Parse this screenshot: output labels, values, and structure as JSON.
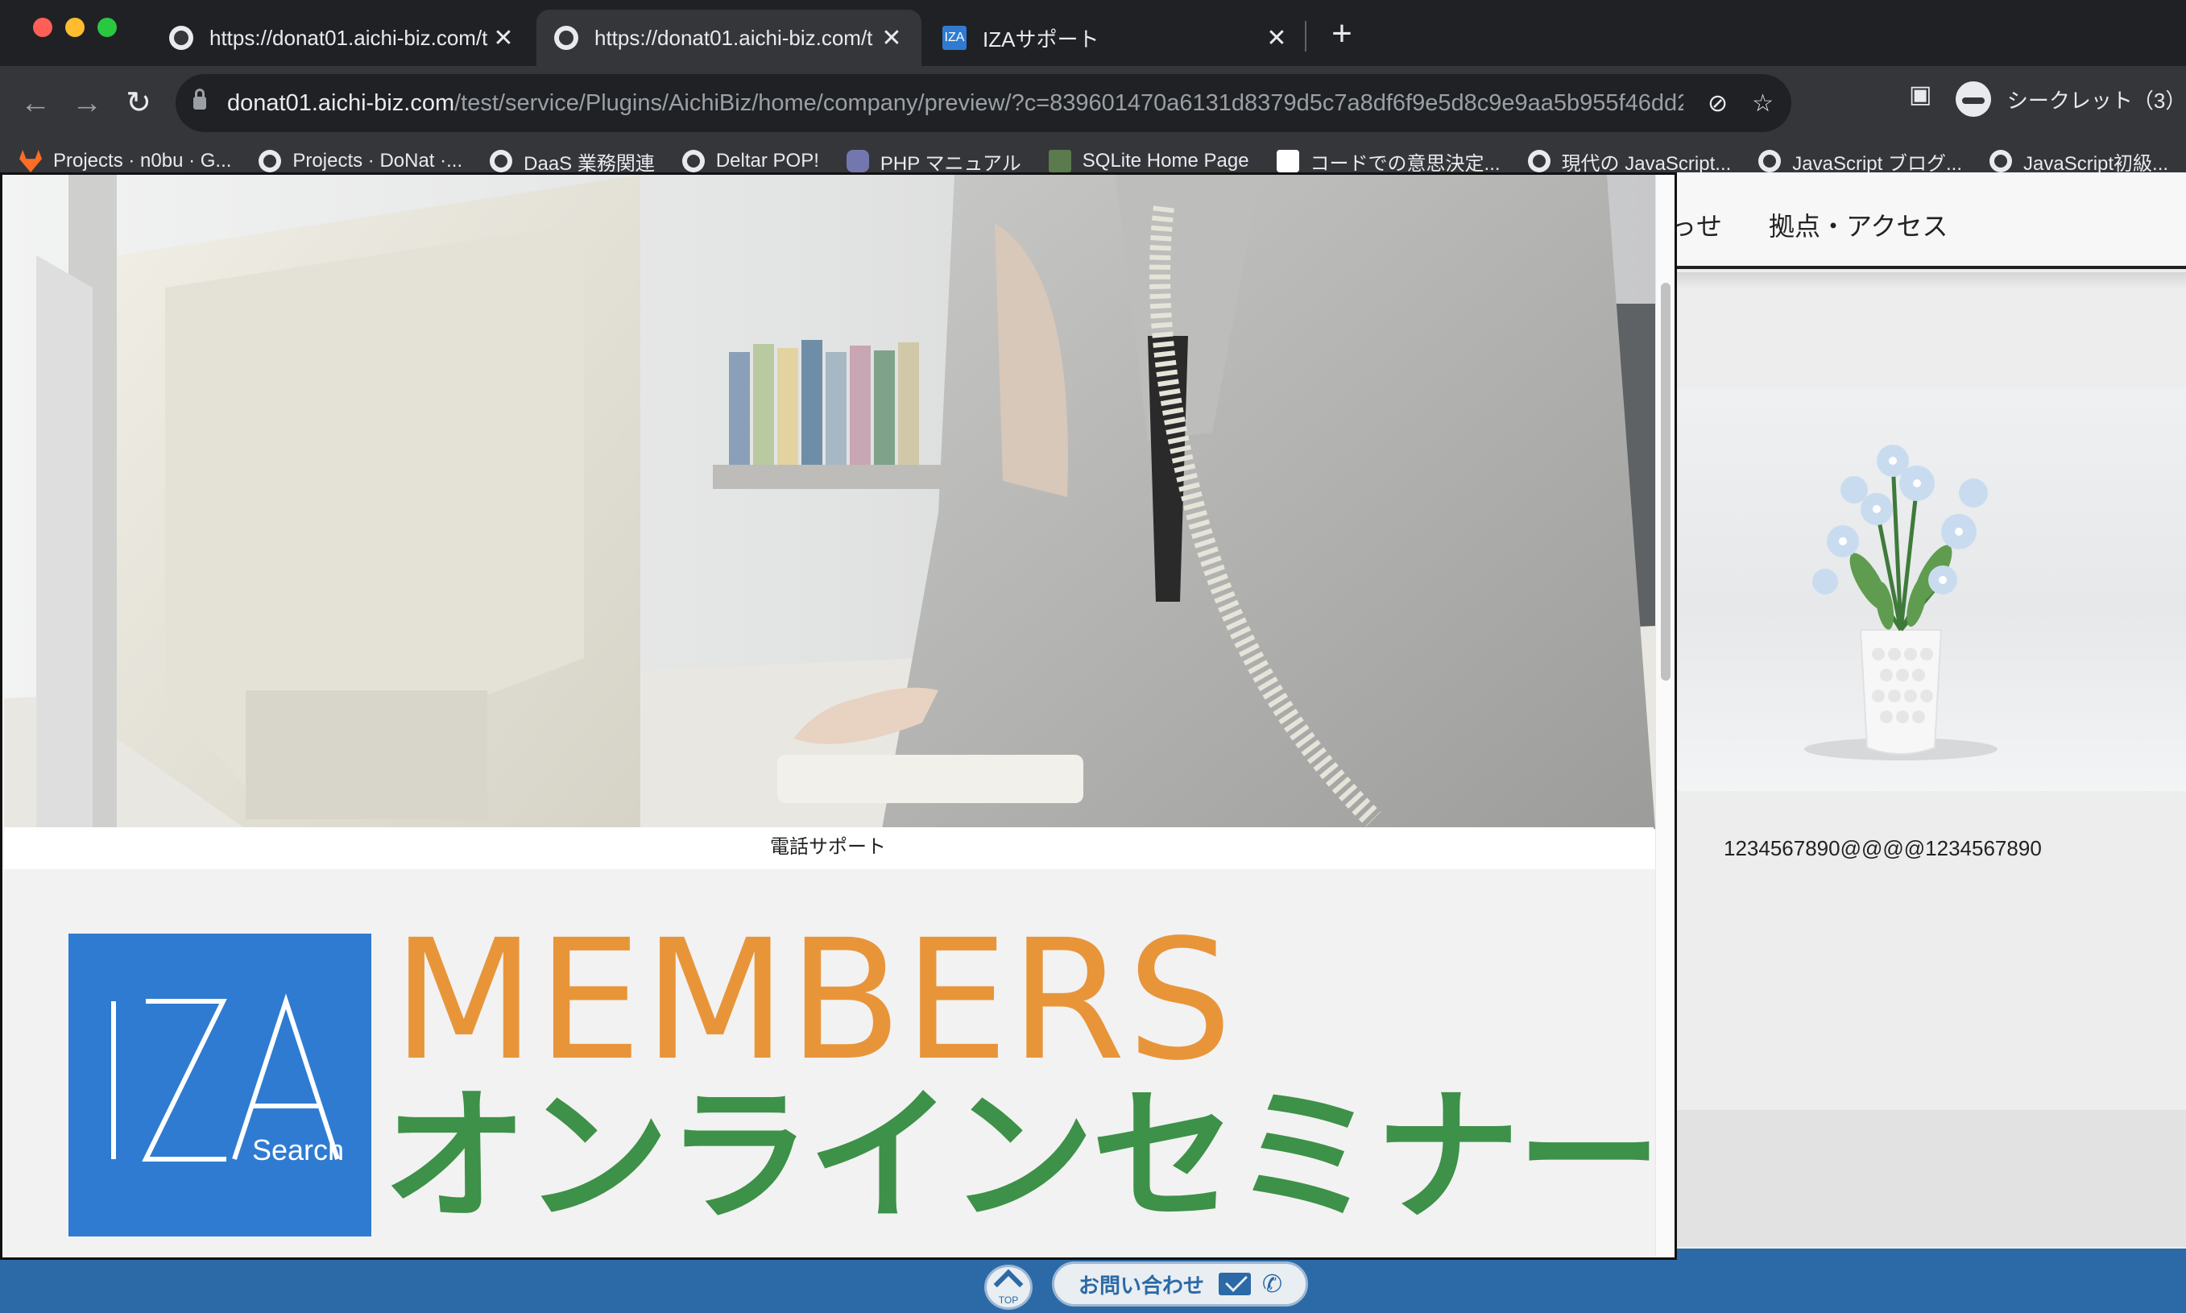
{
  "browser": {
    "tabs": [
      {
        "title": "https://donat01.aichi-biz.com/t",
        "active": false
      },
      {
        "title": "https://donat01.aichi-biz.com/t",
        "active": true
      },
      {
        "title": "IZAサポート",
        "favicon_text": "IZA",
        "active": false
      }
    ],
    "new_tab_label": "+",
    "close_glyph": "✕",
    "url_host": "donat01.aichi-biz.com",
    "url_path": "/test/service/Plugins/AichiBiz/home/company/preview/?c=839601470a6131d8379d5c7a8df6f9e5d8c9e9aa5b955f46dd2...",
    "incognito_label": "シークレット（3）",
    "bookmarks": [
      {
        "label": "Projects · n0bu · G...",
        "icon": "gitlab-icon"
      },
      {
        "label": "Projects · DoNat ·...",
        "icon": "globe-icon"
      },
      {
        "label": "DaaS 業務関連",
        "icon": "globe-icon"
      },
      {
        "label": "Deltar POP!",
        "icon": "globe-icon"
      },
      {
        "label": "PHP マニュアル",
        "icon": "php-icon"
      },
      {
        "label": "SQLite Home Page",
        "icon": "sqlite-icon"
      },
      {
        "label": "コードでの意思決定...",
        "icon": "dark-icon"
      },
      {
        "label": "現代の JavaScript...",
        "icon": "globe-icon"
      },
      {
        "label": "JavaScript ブログ...",
        "icon": "globe-icon"
      },
      {
        "label": "JavaScript初級...",
        "icon": "globe-icon"
      }
    ]
  },
  "background_page": {
    "nav": [
      "っせ",
      "拠点・アクセス"
    ],
    "counter_text": "1234567890@@@@1234567890",
    "top_button_label": "TOP",
    "contact_label": "お問い合わせ"
  },
  "preview": {
    "photo_caption": "電話サポート",
    "banner": {
      "logo_main": "IZA",
      "logo_sub": "Search",
      "headline": "MEMBERS",
      "subheadline": "オンラインセミナー"
    }
  },
  "colors": {
    "members_orange": "#e8953a",
    "seminar_green": "#3d9148",
    "logo_blue": "#2f7bd2",
    "footer_blue": "#2b6aa6"
  }
}
